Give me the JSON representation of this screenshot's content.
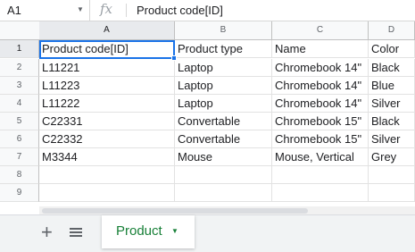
{
  "formula_bar": {
    "cell_ref": "A1",
    "fx_symbol": "fx",
    "content": "Product code[ID]"
  },
  "columns": [
    "A",
    "B",
    "C",
    "D"
  ],
  "rows": [
    {
      "num": "1",
      "cells": [
        "Product code[ID]",
        "Product type",
        "Name",
        "Color"
      ]
    },
    {
      "num": "2",
      "cells": [
        "L11221",
        "Laptop",
        "Chromebook 14\"",
        "Black"
      ]
    },
    {
      "num": "3",
      "cells": [
        "L11223",
        "Laptop",
        "Chromebook 14\"",
        "Blue"
      ]
    },
    {
      "num": "4",
      "cells": [
        "L11222",
        "Laptop",
        "Chromebook 14\"",
        "Silver"
      ]
    },
    {
      "num": "5",
      "cells": [
        "C22331",
        "Convertable",
        "Chromebook 15\"",
        "Black"
      ]
    },
    {
      "num": "6",
      "cells": [
        "C22332",
        "Convertable",
        "Chromebook 15\"",
        "Silver"
      ]
    },
    {
      "num": "7",
      "cells": [
        "M3344",
        "Mouse",
        "Mouse, Vertical",
        "Grey"
      ]
    },
    {
      "num": "8",
      "cells": [
        "",
        "",
        "",
        ""
      ]
    },
    {
      "num": "9",
      "cells": [
        "",
        "",
        "",
        ""
      ]
    }
  ],
  "sheet_tabs": {
    "add_symbol": "+",
    "active_tab": "Product"
  },
  "colors": {
    "selection": "#1a73e8",
    "tab_text": "#188038",
    "header_bg": "#f8f9fa"
  }
}
